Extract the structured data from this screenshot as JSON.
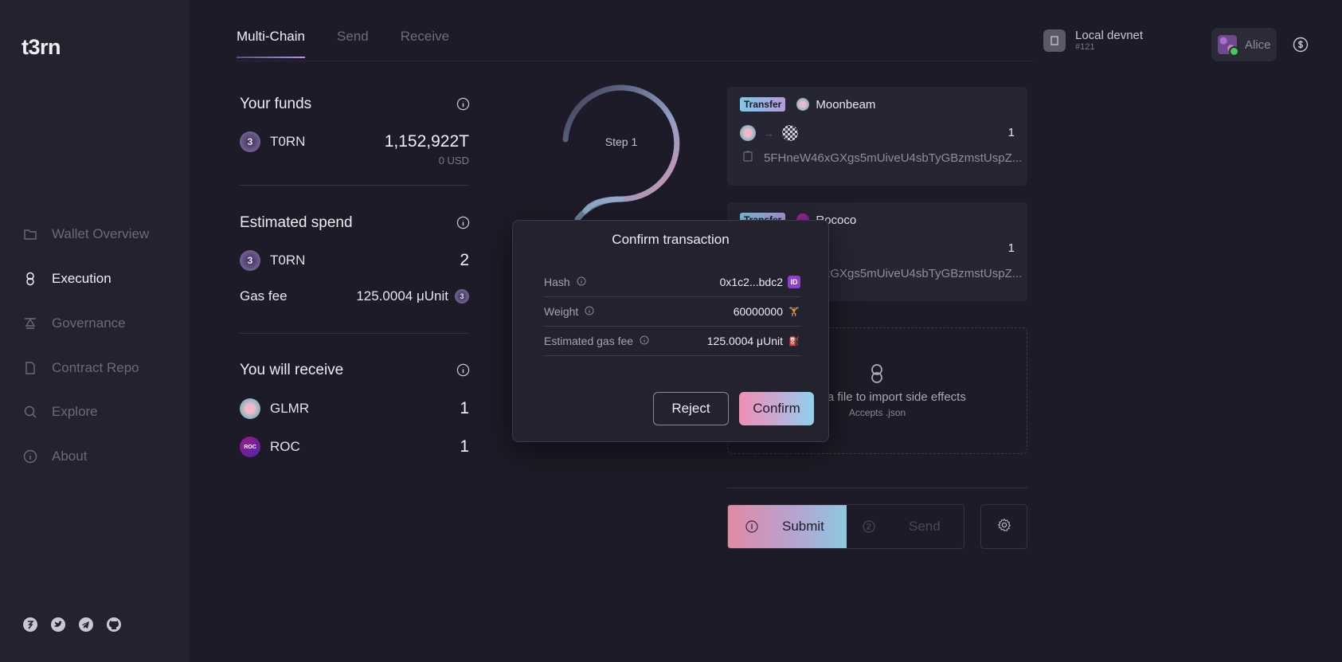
{
  "sidebar": {
    "logo": "t3rn",
    "items": [
      {
        "label": "Wallet Overview",
        "icon": "folder-icon"
      },
      {
        "label": "Execution",
        "icon": "chain-link-icon"
      },
      {
        "label": "Governance",
        "icon": "governance-icon"
      },
      {
        "label": "Contract Repo",
        "icon": "document-icon"
      },
      {
        "label": "Explore",
        "icon": "search-icon"
      },
      {
        "label": "About",
        "icon": "info-icon"
      }
    ],
    "social": [
      "t3rn-icon",
      "twitter-icon",
      "telegram-icon",
      "github-icon"
    ]
  },
  "header": {
    "tabs": [
      "Multi-Chain",
      "Send",
      "Receive"
    ],
    "network_name": "Local devnet",
    "network_id": "#121",
    "account_name": "Alice"
  },
  "summary": {
    "funds": {
      "title": "Your funds",
      "token": "T0RN",
      "amount": "1,152,922T",
      "usd": "0 USD"
    },
    "spend": {
      "title": "Estimated spend",
      "token": "T0RN",
      "amount": "2",
      "gas_label": "Gas fee",
      "gas_value": "125.0004 μUnit"
    },
    "receive": {
      "title": "You will receive",
      "items": [
        {
          "token": "GLMR",
          "amount": "1"
        },
        {
          "token": "ROC",
          "amount": "1"
        }
      ]
    }
  },
  "steps": {
    "label": "Step 1"
  },
  "transfers": [
    {
      "badge": "Transfer",
      "chain": "Moonbeam",
      "amount": "1",
      "address": "5FHneW46xGXgs5mUiveU4sbTyGBzmstUspZ..."
    },
    {
      "badge": "Transfer",
      "chain": "Rococo",
      "amount": "1",
      "address": "5FHneW46xGXgs5mUiveU4sbTyGBzmstUspZ..."
    }
  ],
  "dropzone": {
    "text": "Drop a file to import side effects",
    "sub": "Accepts .json"
  },
  "actions": {
    "submit": "Submit",
    "send": "Send"
  },
  "modal": {
    "title": "Confirm transaction",
    "rows": [
      {
        "label": "Hash",
        "value": "0x1c2...bdc2",
        "emoji": "ID"
      },
      {
        "label": "Weight",
        "value": "60000000",
        "emoji": "🏋"
      },
      {
        "label": "Estimated gas fee",
        "value": "125.0004 μUnit",
        "emoji": "⛽"
      }
    ],
    "reject": "Reject",
    "confirm": "Confirm"
  }
}
